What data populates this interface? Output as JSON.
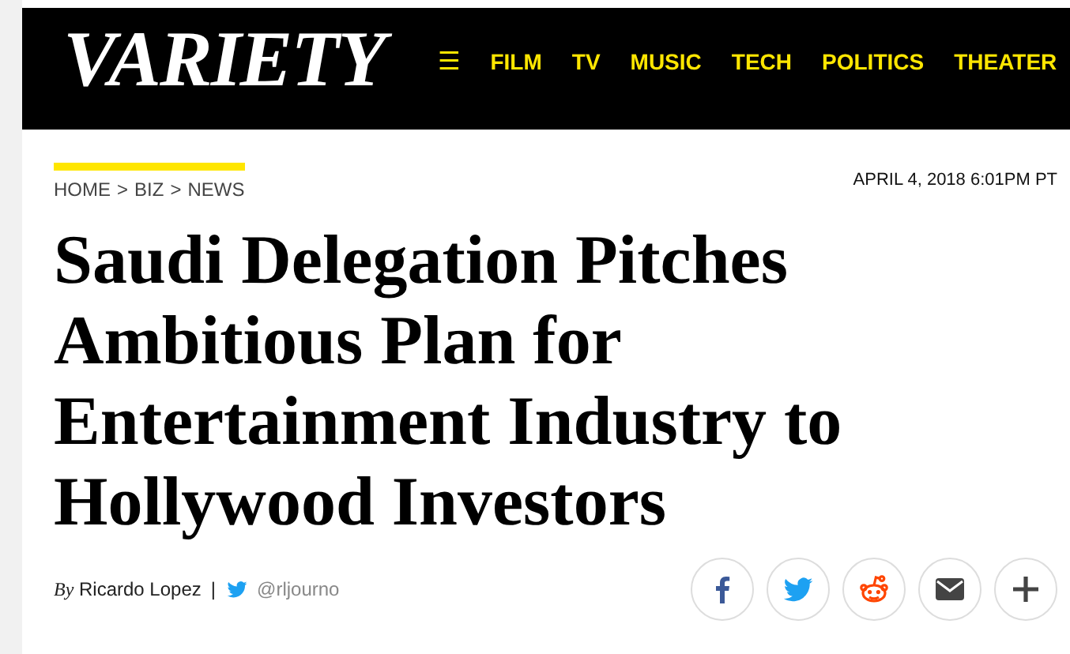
{
  "header": {
    "logo": "VARIETY",
    "menu_icon": "☰",
    "nav": [
      "FILM",
      "TV",
      "MUSIC",
      "TECH",
      "POLITICS",
      "THEATER"
    ]
  },
  "breadcrumb": [
    "HOME",
    "BIZ",
    "NEWS"
  ],
  "breadcrumb_separator": ">",
  "date": "APRIL 4, 2018 6:01PM PT",
  "headline": "Saudi Delegation Pitches Ambitious Plan for Entertainment Industry to Hollywood Investors",
  "byline": {
    "prefix": "By",
    "author": "Ricardo Lopez",
    "separator": "|",
    "twitter": "@rljourno"
  },
  "share": [
    {
      "kind": "facebook"
    },
    {
      "kind": "twitter"
    },
    {
      "kind": "reddit"
    },
    {
      "kind": "email"
    },
    {
      "kind": "more"
    }
  ]
}
